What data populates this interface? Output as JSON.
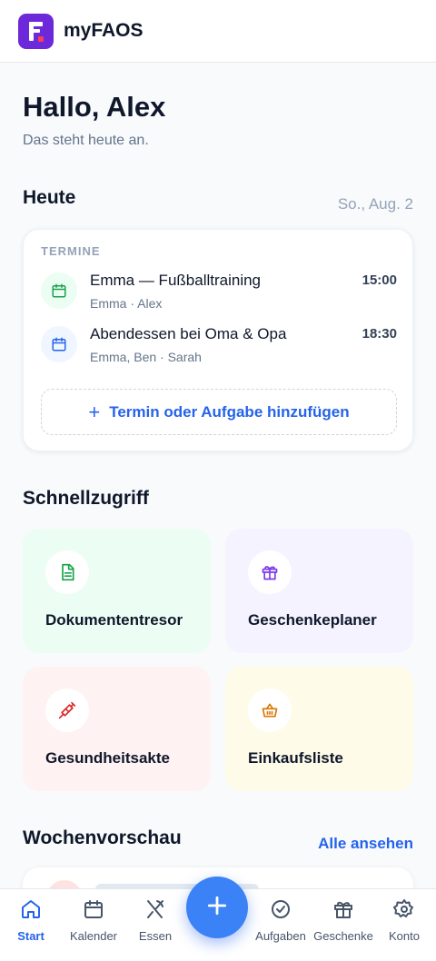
{
  "app": {
    "title": "myFAOS"
  },
  "greeting": {
    "title": "Hallo, Alex",
    "subtitle": "Das steht heute an."
  },
  "today": {
    "section_title": "Heute",
    "date": "So., Aug. 2",
    "card_heading": "TERMINE",
    "events": [
      {
        "title": "Emma — Fußballtraining",
        "people": "Emma · Alex",
        "time": "15:00",
        "icon": "calendar-icon",
        "color": "#16a34a"
      },
      {
        "title": "Abendessen bei Oma & Opa",
        "people": "Emma, Ben · Sarah",
        "time": "18:30",
        "icon": "calendar-icon",
        "color": "#2563eb"
      }
    ],
    "add_label": "Termin oder Aufgabe hinzufügen"
  },
  "quick_access": {
    "section_title": "Schnellzugriff",
    "tiles": [
      {
        "label": "Dokumententresor",
        "icon": "document-icon",
        "bg": "#ecfdf3",
        "accent": "#16a34a"
      },
      {
        "label": "Geschenkeplaner",
        "icon": "gift-icon",
        "bg": "#f5f3ff",
        "accent": "#7c3aed"
      },
      {
        "label": "Gesundheitsakte",
        "icon": "syringe-icon",
        "bg": "#fef2f2",
        "accent": "#dc2626"
      },
      {
        "label": "Einkaufsliste",
        "icon": "basket-icon",
        "bg": "#fefce8",
        "accent": "#d97706"
      }
    ]
  },
  "week_preview": {
    "section_title": "Wochenvorschau",
    "link": "Alle ansehen"
  },
  "bottom_nav": {
    "items": [
      {
        "label": "Start",
        "icon": "home-icon",
        "active": true
      },
      {
        "label": "Kalender",
        "icon": "calendar-icon",
        "active": false
      },
      {
        "label": "Essen",
        "icon": "utensils-icon",
        "active": false
      },
      {
        "label": "Aufgaben",
        "icon": "check-circle-icon",
        "active": false
      },
      {
        "label": "Geschenke",
        "icon": "gift-icon",
        "active": false
      },
      {
        "label": "Konto",
        "icon": "gear-icon",
        "active": false
      }
    ],
    "fab_icon": "plus-icon"
  },
  "colors": {
    "accent": "#2563eb",
    "brand": "#6d28d9"
  }
}
